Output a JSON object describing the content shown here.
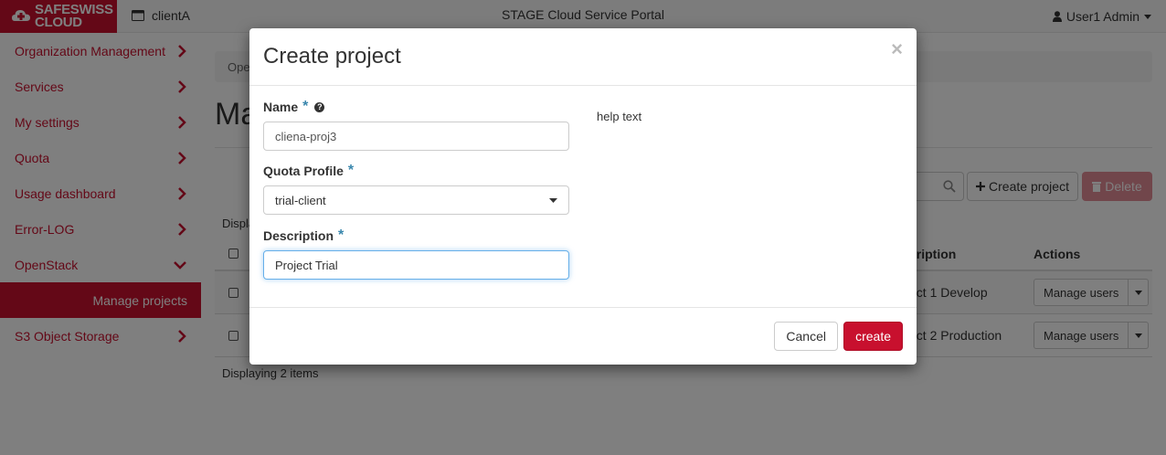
{
  "topbar": {
    "logo_line1": "SAFESWISS",
    "logo_line2": "CLOUD",
    "project_selector": "clientA",
    "portal_title": "STAGE Cloud Service Portal",
    "user": "User1 Admin"
  },
  "sidebar": {
    "items": [
      {
        "label": "Organization Management"
      },
      {
        "label": "Services"
      },
      {
        "label": "My settings"
      },
      {
        "label": "Quota"
      },
      {
        "label": "Usage dashboard"
      },
      {
        "label": "Error-LOG"
      },
      {
        "label": "OpenStack"
      },
      {
        "label": "Manage projects"
      },
      {
        "label": "S3 Object Storage"
      }
    ]
  },
  "main": {
    "breadcrumb": "Ope",
    "page_title": "Ma",
    "toolbar": {
      "create_label": "Create project",
      "delete_label": "Delete"
    },
    "displaying_top": "Displa",
    "table": {
      "headers": {
        "description": "cription",
        "actions": "Actions"
      },
      "rows": [
        {
          "description": "ect 1 Develop",
          "action": "Manage users"
        },
        {
          "description": "ect 2 Production",
          "action": "Manage users"
        }
      ]
    },
    "displaying_bottom": "Displaying 2 items"
  },
  "modal": {
    "title": "Create project",
    "close_symbol": "×",
    "name_label": "Name",
    "name_value": "cliena-proj3",
    "quota_label": "Quota Profile",
    "quota_value": "trial-client",
    "description_label": "Description",
    "description_value": "Project Trial",
    "help_text": "help text",
    "required_mark": "*",
    "cancel_label": "Cancel",
    "submit_label": "create"
  },
  "colors": {
    "brand": "#c8102e",
    "required": "#3a87ad",
    "focus": "#66afe9"
  }
}
